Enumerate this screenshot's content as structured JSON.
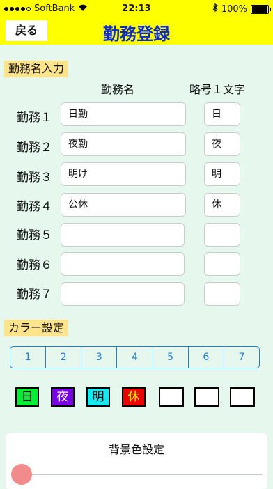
{
  "status_bar": {
    "carrier": "SoftBank",
    "time": "22:13",
    "battery": "100%"
  },
  "nav": {
    "back_label": "戻る",
    "title": "勤務登録"
  },
  "shift_section": {
    "label": "勤務名入力",
    "col_name": "勤務名",
    "col_abbr": "略号１文字",
    "rows": [
      {
        "label": "勤務１",
        "name": "日勤",
        "abbr": "日"
      },
      {
        "label": "勤務２",
        "name": "夜勤",
        "abbr": "夜"
      },
      {
        "label": "勤務３",
        "name": "明け",
        "abbr": "明"
      },
      {
        "label": "勤務４",
        "name": "公休",
        "abbr": "休"
      },
      {
        "label": "勤務５",
        "name": "",
        "abbr": ""
      },
      {
        "label": "勤務６",
        "name": "",
        "abbr": ""
      },
      {
        "label": "勤務７",
        "name": "",
        "abbr": ""
      }
    ]
  },
  "color_section": {
    "label": "カラー設定",
    "segments": [
      "1",
      "2",
      "3",
      "4",
      "5",
      "6",
      "7"
    ],
    "swatches": [
      {
        "text": "日",
        "bg": "#00ee33",
        "fg": "#000000"
      },
      {
        "text": "夜",
        "bg": "#7a00e6",
        "fg": "#ffffff"
      },
      {
        "text": "明",
        "bg": "#16e8f0",
        "fg": "#000000"
      },
      {
        "text": "休",
        "bg": "#ee0000",
        "fg": "#ffff00"
      },
      {
        "text": "",
        "bg": "#ffffff",
        "fg": "#000000"
      },
      {
        "text": "",
        "bg": "#ffffff",
        "fg": "#000000"
      },
      {
        "text": "",
        "bg": "#ffffff",
        "fg": "#000000"
      }
    ]
  },
  "background_section": {
    "label": "背景色設定",
    "slider_value": 0
  }
}
